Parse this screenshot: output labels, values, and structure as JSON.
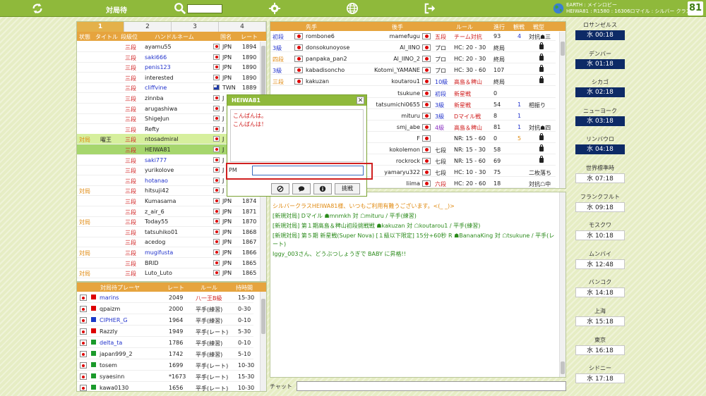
{
  "topbar": {
    "lobby_label": "対局待",
    "status_line1": "EARTH : メインロビー",
    "status_line2": "HEIWA81 : R1580 : 16306ロマイル : シルバー クラス",
    "logo": "81"
  },
  "left_tabs": [
    "1",
    "2",
    "3",
    "4"
  ],
  "player_header": [
    "状態",
    "タイトル",
    "段級位",
    "ハンドルネーム",
    "国名",
    "レート"
  ],
  "players": [
    {
      "state": "",
      "title": "",
      "rank": "三段",
      "name": "ayamu55",
      "country": "JPN",
      "rate": "1894"
    },
    {
      "state": "",
      "title": "",
      "rank": "三段",
      "name": "saki666",
      "country": "JPN",
      "rate": "1890"
    },
    {
      "state": "",
      "title": "",
      "rank": "三段",
      "name": "penis123",
      "country": "JPN",
      "rate": "1890"
    },
    {
      "state": "",
      "title": "",
      "rank": "三段",
      "name": "interested",
      "country": "JPN",
      "rate": "1890"
    },
    {
      "state": "",
      "title": "",
      "rank": "三段",
      "name": "cliffvine",
      "country": "TWN",
      "rate": "1889"
    },
    {
      "state": "",
      "title": "",
      "rank": "三段",
      "name": "zinnba",
      "country": "J",
      "rate": ""
    },
    {
      "state": "",
      "title": "",
      "rank": "三段",
      "name": "arugashiwa",
      "country": "J",
      "rate": ""
    },
    {
      "state": "",
      "title": "",
      "rank": "三段",
      "name": "ShigeJun",
      "country": "J",
      "rate": ""
    },
    {
      "state": "",
      "title": "",
      "rank": "三段",
      "name": "Refty",
      "country": "J",
      "rate": ""
    },
    {
      "state": "対局",
      "title": "曜王",
      "rank": "三段",
      "name": "ntosadmiral",
      "country": "J",
      "rate": ""
    },
    {
      "state": "",
      "title": "",
      "rank": "三段",
      "name": "HEIWA81",
      "country": "J",
      "rate": ""
    },
    {
      "state": "",
      "title": "",
      "rank": "三段",
      "name": "saki777",
      "country": "J",
      "rate": ""
    },
    {
      "state": "",
      "title": "",
      "rank": "三段",
      "name": "yurikolove",
      "country": "J",
      "rate": ""
    },
    {
      "state": "",
      "title": "",
      "rank": "三段",
      "name": "hotanao",
      "country": "J",
      "rate": ""
    },
    {
      "state": "対局",
      "title": "",
      "rank": "三段",
      "name": "hitsuji42",
      "country": "J",
      "rate": ""
    },
    {
      "state": "",
      "title": "",
      "rank": "三段",
      "name": "Kumasama",
      "country": "JPN",
      "rate": "1874"
    },
    {
      "state": "",
      "title": "",
      "rank": "三段",
      "name": "z_air_6",
      "country": "JPN",
      "rate": "1871"
    },
    {
      "state": "対局",
      "title": "",
      "rank": "三段",
      "name": "Today55",
      "country": "JPN",
      "rate": "1870"
    },
    {
      "state": "",
      "title": "",
      "rank": "三段",
      "name": "tatsuhiko01",
      "country": "JPN",
      "rate": "1868"
    },
    {
      "state": "",
      "title": "",
      "rank": "三段",
      "name": "acedog",
      "country": "JPN",
      "rate": "1867"
    },
    {
      "state": "対局",
      "title": "",
      "rank": "三段",
      "name": "mugifusta",
      "country": "JPN",
      "rate": "1866"
    },
    {
      "state": "",
      "title": "",
      "rank": "三段",
      "name": "BRID",
      "country": "JPN",
      "rate": "1865"
    },
    {
      "state": "対局",
      "title": "",
      "rank": "三段",
      "name": "Luto_Luto",
      "country": "JPN",
      "rate": "1865"
    }
  ],
  "waiting_header": [
    "対局待プレーヤ",
    "レート",
    "ルール",
    "持時間"
  ],
  "waiting": [
    {
      "name": "marins",
      "rate": "2049",
      "rule": "八一王B級",
      "time": "15-30"
    },
    {
      "name": "qpaizm",
      "rate": "2000",
      "rule": "平手(練習)",
      "time": "0-30"
    },
    {
      "name": "CIPHER_G",
      "rate": "1964",
      "rule": "平手(練習)",
      "time": "0-10"
    },
    {
      "name": "Razzly",
      "rate": "1949",
      "rule": "平手(レート)",
      "time": "5-30"
    },
    {
      "name": "delta_ta",
      "rate": "1786",
      "rule": "平手(練習)",
      "time": "0-10"
    },
    {
      "name": "japan999_2",
      "rate": "1742",
      "rule": "平手(練習)",
      "time": "5-10"
    },
    {
      "name": "tosem",
      "rate": "1699",
      "rule": "平手(レート)",
      "time": "10-30"
    },
    {
      "name": "syaesinn",
      "rate": "*1673",
      "rule": "平手(レート)",
      "time": "15-30"
    },
    {
      "name": "kawa0130",
      "rate": "1656",
      "rule": "平手(レート)",
      "time": "10-30"
    }
  ],
  "games_header": [
    "先手",
    "後手",
    "ルール",
    "進行",
    "観戦",
    "戦型"
  ],
  "games": [
    {
      "r1": "初段",
      "p1": "rombone6",
      "p2": "mamefugu",
      "r2": "五段",
      "rule": "チーム対抗",
      "moves": "93",
      "watch": "4",
      "style": "対抗☗三"
    },
    {
      "r1": "3級",
      "p1": "donsokunoyose",
      "p2": "Al_IINO",
      "r2": "プロ",
      "rule": "HC: 20 - 30",
      "moves": "終局",
      "watch": "",
      "style": "lock"
    },
    {
      "r1": "四段",
      "p1": "panpaka_pan2",
      "p2": "Al_IINO_2",
      "r2": "プロ",
      "rule": "HC: 20 - 30",
      "moves": "終局",
      "watch": "",
      "style": "lock"
    },
    {
      "r1": "3級",
      "p1": "kabadisoncho",
      "p2": "Kotomi_YAMANE",
      "r2": "プロ",
      "rule": "HC: 30 - 60",
      "moves": "107",
      "watch": "",
      "style": "lock"
    },
    {
      "r1": "三段",
      "p1": "kakuzan",
      "p2": "koutarou1",
      "r2": "10級",
      "rule": "高島＆稗山",
      "moves": "終局",
      "watch": "",
      "style": "lock"
    },
    {
      "r1": "",
      "p1": "",
      "p2": "tsukune",
      "r2": "初段",
      "rule": "新星戦",
      "moves": "0",
      "watch": "",
      "style": ""
    },
    {
      "r1": "",
      "p1": "",
      "p2": "tatsumichi0655",
      "r2": "3級",
      "rule": "新星戦",
      "moves": "54",
      "watch": "1",
      "style": "相振り"
    },
    {
      "r1": "",
      "p1": "",
      "p2": "mituru",
      "r2": "3級",
      "rule": "Dマイル戦",
      "moves": "8",
      "watch": "1",
      "style": ""
    },
    {
      "r1": "",
      "p1": "",
      "p2": "smj_abe",
      "r2": "4級",
      "rule": "高島＆稗山",
      "moves": "81",
      "watch": "1",
      "style": "対抗☗四"
    },
    {
      "r1": "",
      "p1": "",
      "p2": "F",
      "r2": "",
      "rule": "NR: 15 - 60",
      "moves": "0",
      "watch": "5",
      "style": "lock"
    },
    {
      "r1": "",
      "p1": "",
      "p2": "kokolemon",
      "r2": "七段",
      "rule": "NR: 15 - 30",
      "moves": "58",
      "watch": "",
      "style": "lock"
    },
    {
      "r1": "",
      "p1": "",
      "p2": "rockrock",
      "r2": "七段",
      "rule": "NR: 15 - 60",
      "moves": "69",
      "watch": "",
      "style": "lock"
    },
    {
      "r1": "",
      "p1": "",
      "p2": "yamaryu322",
      "r2": "七段",
      "rule": "HC: 10 - 30",
      "moves": "75",
      "watch": "",
      "style": "二枚落ち"
    },
    {
      "r1": "",
      "p1": "",
      "p2": "Iiima",
      "r2": "六段",
      "rule": "HC: 20 - 60",
      "moves": "18",
      "watch": "",
      "style": "対抗☖中"
    }
  ],
  "messages": [
    {
      "text": "シルバークラスHEIWA81様、いつもご利用有難うございます。<(_ _)>",
      "color": "orange"
    },
    {
      "text": "[新規対局] Dマイル ☗mnmkh 対 ☖mituru / 平手(練習)",
      "color": "green"
    },
    {
      "text": "[新規対局] 第１期高島＆稗山初段挑戦戦 ☗kakuzan 対 ☖koutarou1 / 平手(練習)",
      "color": "green"
    },
    {
      "text": "[新規対局] 第５期 新星戦(Super Nova) [１級以下限定] 15分+60秒 R ☗BananaKing 対 ☖tsukune / 平手(レート)",
      "color": "green"
    },
    {
      "text": "Iggy_003さん、どうぶつしょうぎで BABY に昇格!!",
      "color": "green"
    }
  ],
  "chat": {
    "label": "チャット"
  },
  "clocks": [
    {
      "city": "ロサンゼルス",
      "time": "水 00:18",
      "dark": true
    },
    {
      "city": "デンバー",
      "time": "水 01:18",
      "dark": true
    },
    {
      "city": "シカゴ",
      "time": "水 02:18",
      "dark": true
    },
    {
      "city": "ニューヨーク",
      "time": "水 03:18",
      "dark": true
    },
    {
      "city": "リンバウロ",
      "time": "水 04:18",
      "dark": true
    },
    {
      "city": "世界標準時",
      "time": "水 07:18",
      "dark": false
    },
    {
      "city": "フランクフルト",
      "time": "水 09:18",
      "dark": false
    },
    {
      "city": "モスクワ",
      "time": "水 10:18",
      "dark": false
    },
    {
      "city": "ムンバイ",
      "time": "水 12:48",
      "dark": false
    },
    {
      "city": "バンコク",
      "time": "水 14:18",
      "dark": false
    },
    {
      "city": "上海",
      "time": "水 15:18",
      "dark": false
    },
    {
      "city": "東京",
      "time": "水 16:18",
      "dark": false
    },
    {
      "city": "シドニー",
      "time": "水 17:18",
      "dark": false
    }
  ],
  "dialog": {
    "title": "HEIWA81",
    "close": "✕",
    "lines": [
      "こんばんは。",
      "こんばんは！"
    ],
    "pm_label": "PM",
    "challenge": "挑戦"
  }
}
